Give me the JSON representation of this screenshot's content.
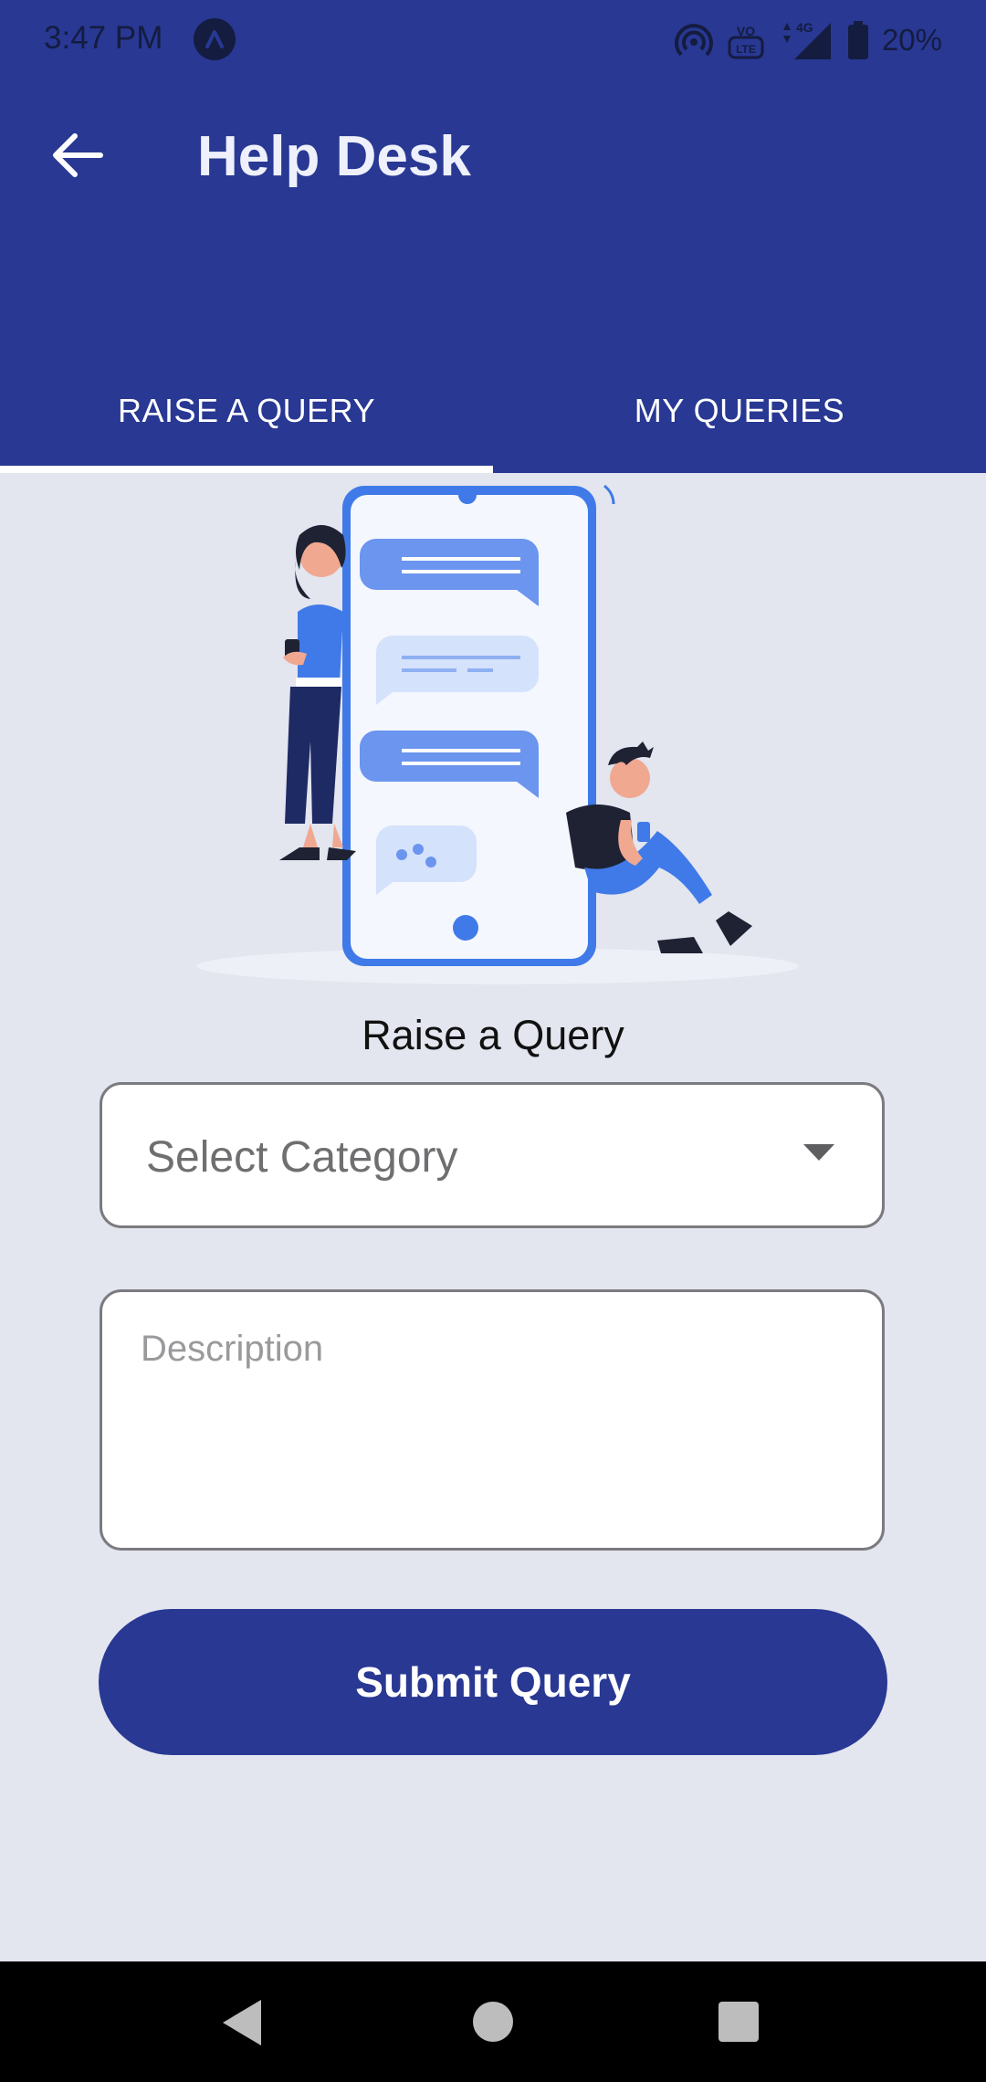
{
  "status_bar": {
    "time": "3:47 PM",
    "network": "4G",
    "volte": "Vo LTE",
    "battery": "20%"
  },
  "header": {
    "title": "Help Desk"
  },
  "tabs": [
    {
      "label": "RAISE A QUERY",
      "selected": true
    },
    {
      "label": "MY QUERIES",
      "selected": false
    }
  ],
  "form": {
    "heading": "Raise a Query",
    "category_placeholder": "Select Category",
    "description_placeholder": "Description",
    "submit_label": "Submit Query"
  },
  "colors": {
    "primary": "#283893",
    "background": "#e3e5ef",
    "accent_illustration": "#4a7df0"
  }
}
